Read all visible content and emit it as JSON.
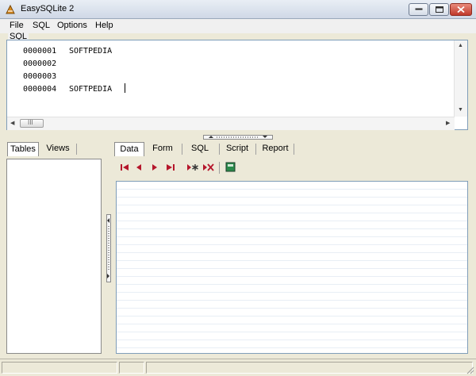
{
  "window": {
    "title": "EasySQLite 2"
  },
  "menu": {
    "items": [
      "File",
      "SQL",
      "Options",
      "Help"
    ]
  },
  "sql_editor": {
    "group_label": "SQL",
    "lines": [
      {
        "number": "0000001",
        "text": "SOFTPEDIA"
      },
      {
        "number": "0000002",
        "text": ""
      },
      {
        "number": "0000003",
        "text": ""
      },
      {
        "number": "0000004",
        "text": "SOFTPEDIA"
      }
    ],
    "hscroll_thumb_label": "III"
  },
  "left_tabs": {
    "items": [
      "Tables",
      "Views"
    ],
    "active": "Tables"
  },
  "right_tabs": {
    "items": [
      "Data",
      "Form",
      "SQL",
      "Script",
      "Report"
    ],
    "active": "Data"
  },
  "toolbar": {
    "icons": [
      "first-record-icon",
      "prev-record-icon",
      "next-record-icon",
      "last-record-icon",
      "insert-record-icon",
      "delete-record-icon",
      "commit-icon"
    ]
  },
  "colors": {
    "accent_red": "#b5162b",
    "green": "#2a8a4a"
  }
}
